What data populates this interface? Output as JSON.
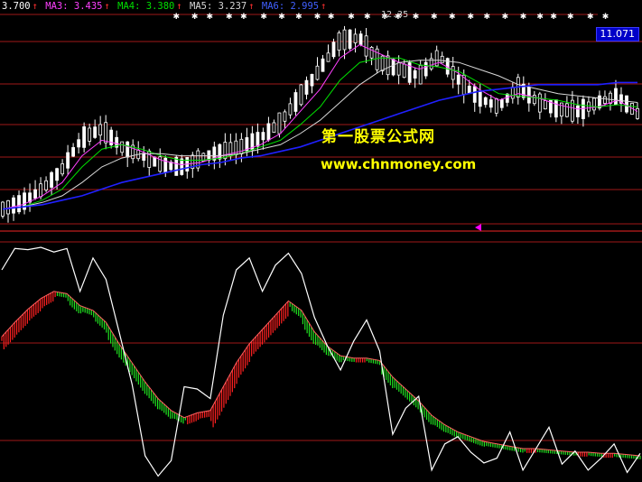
{
  "legend": {
    "ma2": "3.700",
    "ma3": "MA3: 3.435",
    "ma4": "MA4: 3.380",
    "ma5": "MA5: 3.237",
    "ma6": "MA6: 2.995",
    "arrow": "↑"
  },
  "price_tag": "11.071",
  "high_label": "12.35",
  "watermark": {
    "line1": "第一股票公式网",
    "line2": "www.chnmoney.com"
  },
  "colors": {
    "background": "#000000",
    "grid_line": "#a01818",
    "up_candle": "#ffffff",
    "ma2": "#ffffff",
    "ma3": "#ff40ff",
    "ma4": "#00e000",
    "ma5": "#d8d8d8",
    "ma6": "#2020ff",
    "osc_line": "#ffffff",
    "osc_up": "#ff2020",
    "osc_down": "#20e020",
    "price_tag_bg": "#0000c8",
    "watermark": "#ffff00",
    "marker": "#ff00ff"
  },
  "chart_data": [
    {
      "type": "line",
      "panel": "price",
      "title": "",
      "series": [
        {
          "name": "MA3",
          "values": [
            4.0,
            4.2,
            4.6,
            5.2,
            6.4,
            7.1,
            6.9,
            6.6,
            6.2,
            6.0,
            6.1,
            6.4,
            6.6,
            6.9,
            7.4,
            8.4,
            9.4,
            10.8,
            11.4,
            11.0,
            10.6,
            10.3,
            10.6,
            10.1,
            9.4,
            8.9,
            9.2,
            9.0,
            8.7,
            8.5,
            8.6,
            8.9,
            8.4
          ]
        },
        {
          "name": "MA4",
          "values": [
            4.0,
            4.1,
            4.4,
            4.9,
            5.9,
            6.7,
            6.9,
            6.7,
            6.4,
            6.2,
            6.2,
            6.3,
            6.5,
            6.8,
            7.1,
            7.8,
            8.6,
            9.8,
            10.6,
            10.8,
            10.8,
            10.5,
            10.4,
            10.2,
            9.7,
            9.2,
            9.1,
            9.0,
            8.9,
            8.7,
            8.6,
            8.7,
            8.6
          ]
        },
        {
          "name": "MA5",
          "values": [
            4.0,
            4.1,
            4.3,
            4.6,
            5.2,
            5.9,
            6.3,
            6.5,
            6.5,
            6.4,
            6.4,
            6.4,
            6.5,
            6.7,
            6.9,
            7.4,
            8.0,
            8.8,
            9.6,
            10.2,
            10.6,
            10.7,
            10.7,
            10.6,
            10.3,
            10.0,
            9.6,
            9.4,
            9.2,
            9.1,
            9.0,
            8.9,
            8.8
          ]
        },
        {
          "name": "MA6",
          "values": [
            4.0,
            4.1,
            4.2,
            4.4,
            4.6,
            4.9,
            5.2,
            5.4,
            5.6,
            5.8,
            6.0,
            6.1,
            6.3,
            6.4,
            6.6,
            6.8,
            7.1,
            7.4,
            7.7,
            8.0,
            8.3,
            8.6,
            8.9,
            9.1,
            9.3,
            9.4,
            9.5,
            9.6,
            9.6,
            9.6,
            9.6,
            9.7,
            9.7
          ]
        }
      ],
      "closes": [
        4.0,
        4.3,
        4.9,
        5.8,
        7.2,
        7.6,
        6.8,
        6.4,
        6.0,
        5.9,
        6.3,
        6.6,
        6.8,
        7.2,
        7.9,
        9.1,
        10.3,
        11.6,
        11.7,
        10.6,
        10.3,
        10.0,
        10.9,
        9.8,
        9.0,
        8.6,
        9.5,
        8.8,
        8.5,
        8.4,
        8.8,
        9.1,
        8.3
      ],
      "ylim": [
        3.5,
        12.6
      ],
      "max_label": "12.35",
      "last_price": "11.071"
    },
    {
      "type": "line",
      "panel": "oscillator",
      "series": [
        {
          "name": "",
          "values": [
            78,
            96,
            95,
            97,
            93,
            96,
            60,
            88,
            70,
            26,
            -18,
            -78,
            -95,
            -82,
            -20,
            -22,
            -30,
            40,
            78,
            88,
            60,
            82,
            92,
            75,
            38,
            14,
            -6,
            18,
            36,
            10,
            -60,
            -38,
            -28,
            -90,
            -68,
            -62,
            -75,
            -84,
            -80,
            -58,
            -90,
            -72,
            -54,
            -85,
            -74,
            -90,
            -80,
            -68,
            -92,
            -76
          ]
        },
        {
          "name": "",
          "values": [
            22,
            34,
            45,
            54,
            60,
            58,
            48,
            44,
            34,
            16,
            0,
            -16,
            -30,
            -40,
            -46,
            -42,
            -40,
            -20,
            0,
            16,
            28,
            40,
            52,
            44,
            26,
            14,
            6,
            4,
            4,
            2,
            -12,
            -22,
            -32,
            -44,
            -52,
            -58,
            -62,
            -66,
            -68,
            -70,
            -72,
            -72,
            -73,
            -74,
            -75,
            -75,
            -76,
            -76,
            -77,
            -78
          ]
        }
      ],
      "ylim": [
        -100,
        100
      ]
    }
  ]
}
